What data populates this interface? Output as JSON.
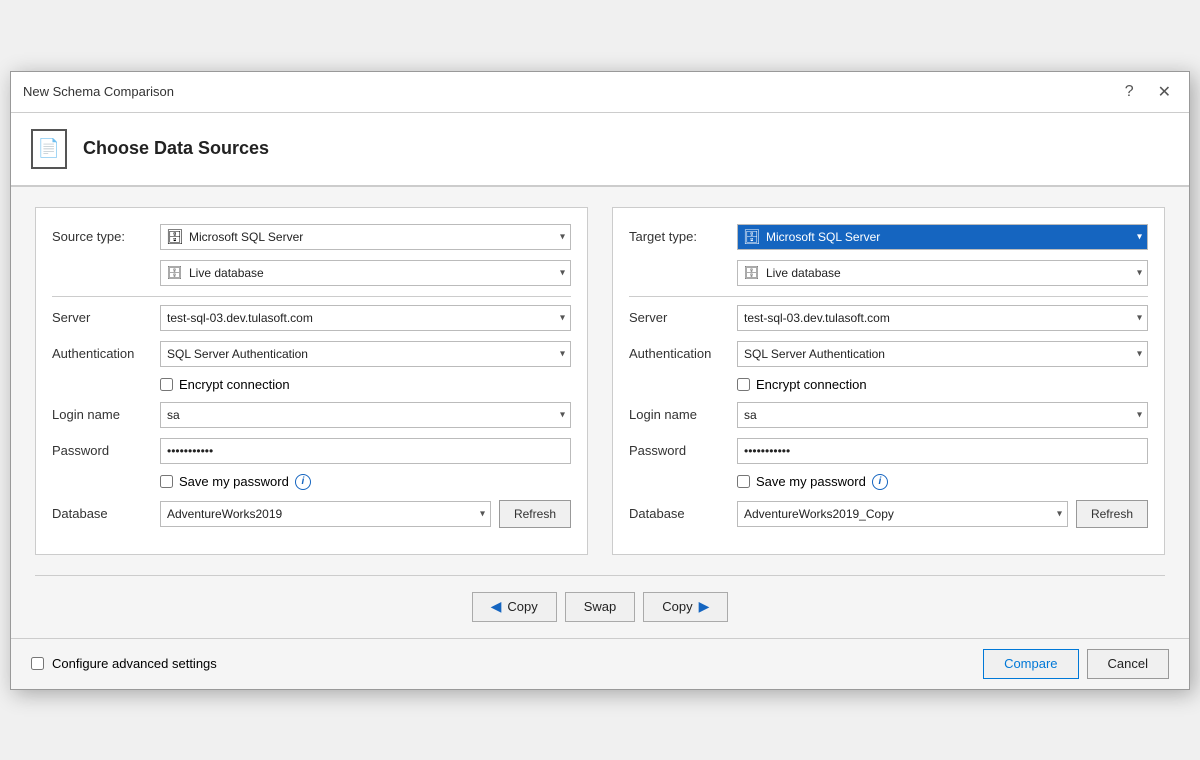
{
  "dialog": {
    "title": "New Schema Comparison",
    "header_title": "Choose Data Sources",
    "help_btn": "?",
    "close_btn": "✕"
  },
  "source": {
    "type_label": "Source type:",
    "type_options": [
      "Microsoft SQL Server"
    ],
    "type_selected": "Microsoft SQL Server",
    "subtype_options": [
      "Live database"
    ],
    "subtype_selected": "Live database",
    "server_label": "Server",
    "server_value": "test-sql-03.dev.tulasoft.com",
    "auth_label": "Authentication",
    "auth_options": [
      "SQL Server Authentication"
    ],
    "auth_selected": "SQL Server Authentication",
    "encrypt_label": "Encrypt connection",
    "login_label": "Login name",
    "login_value": "sa",
    "password_label": "Password",
    "password_value": "***********",
    "save_password_label": "Save my password",
    "database_label": "Database",
    "database_value": "AdventureWorks2019",
    "refresh_label": "Refresh"
  },
  "target": {
    "type_label": "Target type:",
    "type_options": [
      "Microsoft SQL Server"
    ],
    "type_selected": "Microsoft SQL Server",
    "subtype_options": [
      "Live database"
    ],
    "subtype_selected": "Live database",
    "server_label": "Server",
    "server_value": "test-sql-03.dev.tulasoft.com",
    "auth_label": "Authentication",
    "auth_options": [
      "SQL Server Authentication"
    ],
    "auth_selected": "SQL Server Authentication",
    "encrypt_label": "Encrypt connection",
    "login_label": "Login name",
    "login_value": "sa",
    "password_label": "Password",
    "password_value": "***********",
    "save_password_label": "Save my password",
    "database_label": "Database",
    "database_value": "AdventureWorks2019_Copy",
    "refresh_label": "Refresh"
  },
  "actions": {
    "copy_left_label": "Copy",
    "swap_label": "Swap",
    "copy_right_label": "Copy"
  },
  "footer": {
    "advanced_label": "Configure advanced settings",
    "compare_label": "Compare",
    "cancel_label": "Cancel"
  }
}
